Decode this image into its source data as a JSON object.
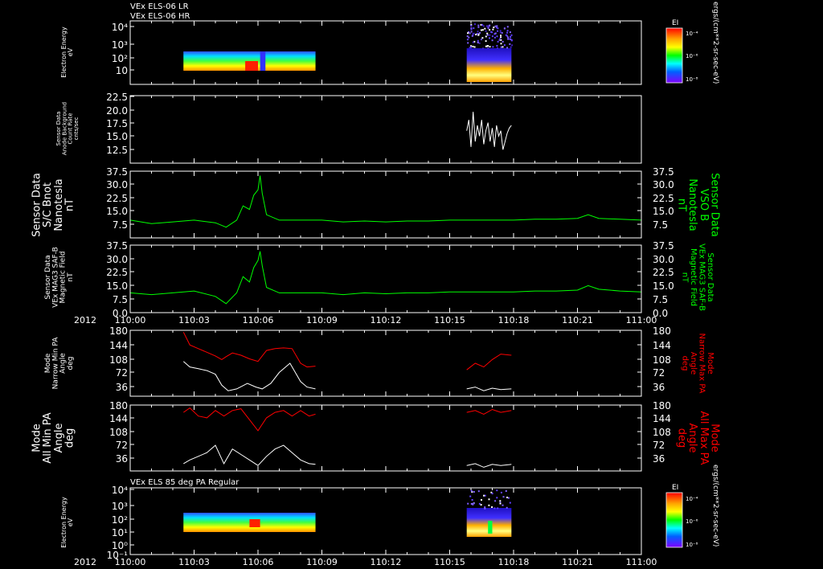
{
  "header": {
    "line1": "VEx ELS-06 LR",
    "line2": "VEx ELS-06 HR"
  },
  "footer_title": "VEx ELS 85 deg PA Regular",
  "time_axis": {
    "year": "2012",
    "ticks": [
      "110:00",
      "110:03",
      "110:06",
      "110:09",
      "110:12",
      "110:15",
      "110:18",
      "110:21",
      "111:00"
    ],
    "range_minutes": [
      0,
      24
    ]
  },
  "colorbar": {
    "title": "EI",
    "ticks": [
      "10⁻⁴",
      "10⁻⁶",
      "10⁻⁸"
    ],
    "unit": "ergs/(cm**2-sr-sec-eV)"
  },
  "colors": {
    "background": "#000000",
    "white": "#ffffff",
    "green": "#00ff00",
    "red": "#ff0000",
    "axis": "#ffffff"
  },
  "chart_data": [
    {
      "type": "heatmap",
      "panel": "els-lr-hr-spectrogram",
      "ylabel": [
        "Electron Energy",
        "eV"
      ],
      "yticks": [
        "10⁴",
        "10³",
        "10²",
        "10"
      ],
      "y_log": true,
      "active_intervals_min": [
        [
          2.5,
          8.7
        ],
        [
          15.8,
          17.9
        ]
      ]
    },
    {
      "type": "line",
      "panel": "anode-background",
      "ylabel": [
        "Sensor Data",
        "Anode Background",
        "Count Rate",
        "cnts/sec"
      ],
      "ylim": [
        10,
        22.5
      ],
      "yticks": [
        "22.5",
        "20.0",
        "17.5",
        "15.0",
        "12.5"
      ],
      "series": [
        {
          "color": "#ffffff",
          "x_min": [
            15.8,
            15.9,
            16.0,
            16.1,
            16.2,
            16.3,
            16.4,
            16.5,
            16.6,
            16.7,
            16.8,
            16.9,
            17.0,
            17.1,
            17.2,
            17.3,
            17.4,
            17.5,
            17.6,
            17.7,
            17.8,
            17.9
          ],
          "values": [
            16,
            18,
            13,
            19.5,
            14,
            17,
            15,
            18,
            13.5,
            16,
            17.5,
            14,
            16.5,
            13,
            17,
            15,
            16,
            12.5,
            14,
            15.5,
            16.5,
            17
          ]
        }
      ]
    },
    {
      "type": "line",
      "panel": "sc-bnot",
      "ylabel": [
        "Sensor Data",
        "S/C Bnot",
        "Nanotesla",
        "nT"
      ],
      "ylabel_right": [
        "Sensor Data",
        "VSO B",
        "Nanotesla",
        "nT"
      ],
      "ylim": [
        0,
        37.5
      ],
      "yticks": [
        "37.5",
        "30.0",
        "22.5",
        "15.0",
        "7.5"
      ],
      "series": [
        {
          "color": "#00ff00",
          "x_min": [
            0,
            1,
            2,
            3,
            4,
            4.5,
            5,
            5.3,
            5.6,
            5.8,
            6.0,
            6.1,
            6.2,
            6.4,
            7,
            8,
            9,
            10,
            11,
            12,
            13,
            14,
            15,
            16,
            17,
            18,
            19,
            20,
            21,
            21.5,
            22,
            23,
            24
          ],
          "values": [
            10,
            8,
            9,
            10,
            8.5,
            6,
            10,
            18,
            16,
            24,
            27,
            35,
            25,
            13,
            10,
            10,
            10,
            9,
            9.5,
            9,
            9.5,
            9.5,
            10,
            10,
            10,
            10,
            10.5,
            10.5,
            11,
            13,
            11,
            10.5,
            10
          ]
        }
      ]
    },
    {
      "type": "line",
      "panel": "mag3-saf-b",
      "ylabel": [
        "Sensor Data",
        "VEx MAG3 SAF-B",
        "Magnetic Field",
        "nT"
      ],
      "ylabel_right": [
        "Sensor Data",
        "VEx MAG3 SAF-B",
        "Magnetic Field",
        "nT"
      ],
      "ylim": [
        0,
        37.5
      ],
      "yticks": [
        "37.5",
        "30.0",
        "22.5",
        "15.0",
        "7.5",
        "0.0"
      ],
      "series": [
        {
          "color": "#00ff00",
          "x_min": [
            0,
            1,
            2,
            3,
            4,
            4.5,
            5,
            5.3,
            5.6,
            5.8,
            6.0,
            6.1,
            6.2,
            6.4,
            7,
            8,
            9,
            10,
            11,
            12,
            13,
            14,
            15,
            16,
            17,
            18,
            19,
            20,
            21,
            21.5,
            22,
            23,
            24
          ],
          "values": [
            11,
            10,
            11,
            12,
            9,
            5,
            11,
            20,
            17,
            25,
            29,
            34,
            26,
            14,
            11,
            11,
            11,
            10,
            11,
            10.5,
            11,
            11,
            11.5,
            11.5,
            11.5,
            11.5,
            12,
            12,
            12.5,
            15,
            13,
            12,
            11.5
          ]
        }
      ]
    },
    {
      "type": "line",
      "panel": "narrow-pa",
      "ylabel": [
        "Mode",
        "Narrow Min PA",
        "Angle",
        "deg"
      ],
      "ylabel_right": [
        "Mode",
        "Narrow Max PA",
        "Angle",
        "deg"
      ],
      "ylim": [
        0,
        180
      ],
      "yticks": [
        "180",
        "144",
        "108",
        "72",
        "36"
      ],
      "series": [
        {
          "name": "Narrow Max PA",
          "color": "#ff0000",
          "x_min": [
            2.5,
            2.8,
            3.2,
            3.6,
            4.0,
            4.3,
            4.5,
            4.8,
            5.2,
            5.6,
            6.0,
            6.4,
            6.8,
            7.2,
            7.6,
            8.0,
            8.3,
            8.7
          ],
          "values": [
            175,
            140,
            130,
            120,
            110,
            100,
            108,
            118,
            112,
            102,
            95,
            125,
            130,
            132,
            130,
            90,
            80,
            82
          ]
        },
        {
          "name": "Narrow Max PA",
          "color": "#ff0000",
          "x_min": [
            15.8,
            16.2,
            16.6,
            17.0,
            17.4,
            17.9
          ],
          "values": [
            72,
            90,
            80,
            100,
            115,
            112
          ]
        },
        {
          "name": "Narrow Min PA",
          "color": "#ffffff",
          "x_min": [
            2.5,
            2.8,
            3.2,
            3.6,
            4.0,
            4.3,
            4.6,
            5.0,
            5.5,
            5.9,
            6.2,
            6.6,
            7.0,
            7.5,
            8.0,
            8.3,
            8.7
          ],
          "values": [
            95,
            80,
            75,
            70,
            60,
            30,
            15,
            20,
            35,
            25,
            20,
            35,
            65,
            90,
            40,
            25,
            20
          ]
        },
        {
          "name": "Narrow Min PA",
          "color": "#ffffff",
          "x_min": [
            15.8,
            16.2,
            16.6,
            17.0,
            17.4,
            17.9
          ],
          "values": [
            20,
            25,
            15,
            22,
            18,
            20
          ]
        }
      ]
    },
    {
      "type": "line",
      "panel": "all-pa",
      "ylabel": [
        "Mode",
        "All Min PA",
        "Angle",
        "deg"
      ],
      "ylabel_right": [
        "Mode",
        "All Max PA",
        "Angle",
        "deg"
      ],
      "ylim": [
        0,
        180
      ],
      "yticks": [
        "180",
        "144",
        "108",
        "72",
        "36"
      ],
      "series": [
        {
          "name": "All Max PA",
          "color": "#ff0000",
          "x_min": [
            2.5,
            2.8,
            3.2,
            3.6,
            4.0,
            4.4,
            4.8,
            5.2,
            5.6,
            6.0,
            6.4,
            6.8,
            7.2,
            7.6,
            8.0,
            8.4,
            8.7
          ],
          "values": [
            160,
            172,
            150,
            145,
            165,
            150,
            165,
            170,
            140,
            110,
            145,
            160,
            165,
            150,
            165,
            150,
            155
          ]
        },
        {
          "name": "All Max PA",
          "color": "#ff0000",
          "x_min": [
            15.8,
            16.2,
            16.6,
            17.0,
            17.4,
            17.9
          ],
          "values": [
            160,
            165,
            155,
            168,
            160,
            165
          ]
        },
        {
          "name": "All Min PA",
          "color": "#ffffff",
          "x_min": [
            2.5,
            2.8,
            3.2,
            3.6,
            4.0,
            4.4,
            4.8,
            5.2,
            5.6,
            6.0,
            6.4,
            6.8,
            7.2,
            7.6,
            8.0,
            8.4,
            8.7
          ],
          "values": [
            20,
            30,
            40,
            50,
            70,
            20,
            60,
            45,
            30,
            15,
            40,
            60,
            70,
            50,
            30,
            20,
            18
          ]
        },
        {
          "name": "All Min PA",
          "color": "#ffffff",
          "x_min": [
            15.8,
            16.2,
            16.6,
            17.0,
            17.4,
            17.9
          ],
          "values": [
            15,
            20,
            10,
            18,
            15,
            18
          ]
        }
      ]
    },
    {
      "type": "heatmap",
      "panel": "els-85-deg-spectrogram",
      "ylabel": [
        "Electron Energy",
        "eV"
      ],
      "yticks": [
        "10⁴",
        "10³",
        "10²",
        "10¹",
        "10⁰",
        "10⁻¹"
      ],
      "y_log": true,
      "active_intervals_min": [
        [
          2.5,
          8.7
        ],
        [
          15.8,
          17.9
        ]
      ]
    }
  ]
}
